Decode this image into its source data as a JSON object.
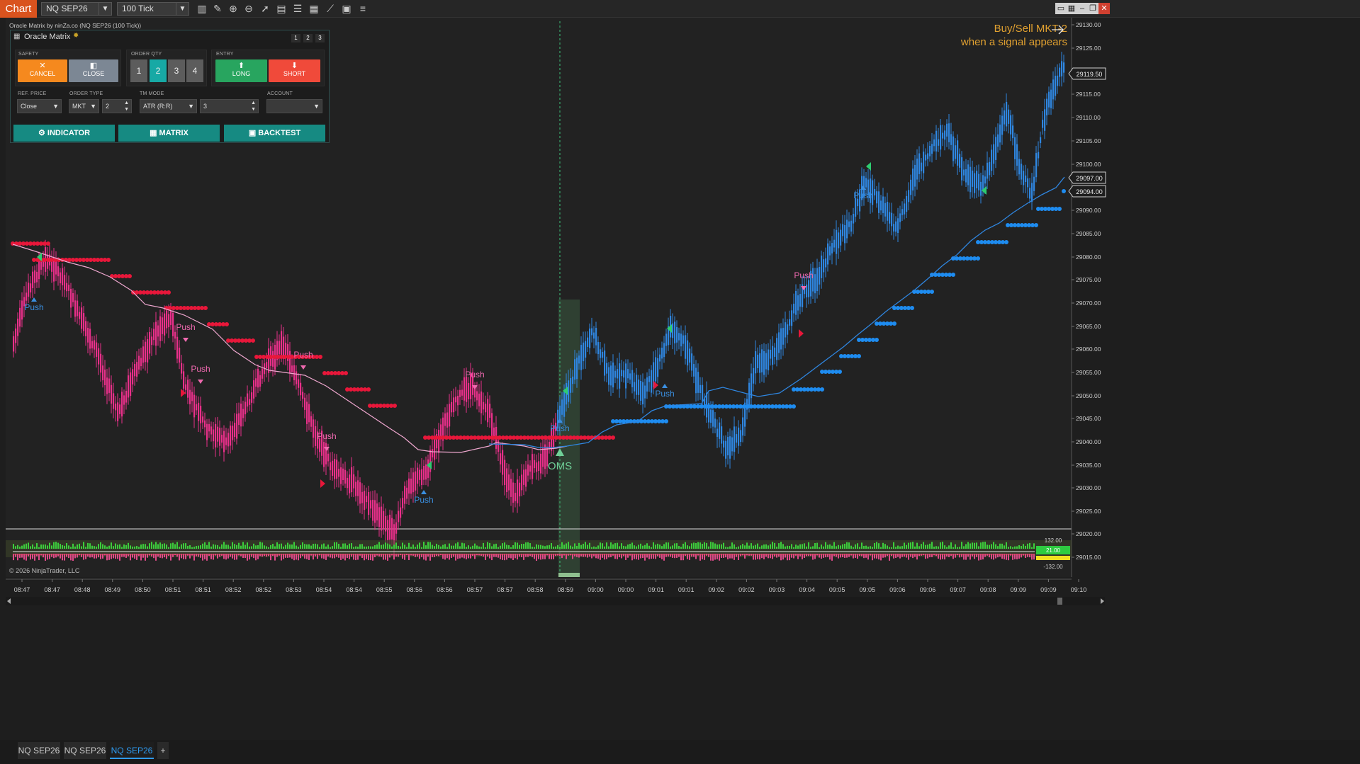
{
  "toolbar": {
    "chart_tab": "Chart",
    "instrument": "NQ SEP26",
    "interval": "100 Tick",
    "icons": [
      "bar-chart-icon",
      "draw-pencil-icon",
      "zoom-in-icon",
      "zoom-out-icon",
      "pointer-icon",
      "data-box-icon",
      "template-icon",
      "strategy-icon",
      "indicator-icon",
      "properties-icon",
      "list-icon"
    ]
  },
  "chart": {
    "title": "Oracle Matrix by ninZa.co (NQ SEP26 (100 Tick))",
    "copyright": "© 2026 NinjaTrader, LLC",
    "annotation_line1": "Buy/Sell MKT-2",
    "annotation_line2": "when a signal appears",
    "oms_label": "OMS",
    "push_label": "Push",
    "price_ticks": [
      "29130.00",
      "29125.00",
      "29115.00",
      "29110.00",
      "29105.00",
      "29100.00",
      "29090.00",
      "29085.00",
      "29080.00",
      "29075.00",
      "29070.00",
      "29065.00",
      "29060.00",
      "29055.00",
      "29050.00",
      "29045.00",
      "29040.00",
      "29035.00",
      "29030.00",
      "29025.00",
      "29020.00",
      "29015.00"
    ],
    "price_marker_last": "29119.50",
    "price_marker_2": "29097.00",
    "price_marker_3": "29094.00",
    "osc_top": "132.00",
    "osc_value": "21.00",
    "osc_bottom": "-132.00",
    "time_ticks": [
      "08:47",
      "08:47",
      "08:48",
      "08:49",
      "08:50",
      "08:51",
      "08:51",
      "08:52",
      "08:52",
      "08:53",
      "08:54",
      "08:54",
      "08:55",
      "08:56",
      "08:56",
      "08:57",
      "08:57",
      "08:58",
      "08:59",
      "09:00",
      "09:00",
      "09:01",
      "09:01",
      "09:02",
      "09:02",
      "09:03",
      "09:04",
      "09:05",
      "09:05",
      "09:06",
      "09:06",
      "09:07",
      "09:08",
      "09:09",
      "09:09",
      "09:10"
    ],
    "colors": {
      "bull": "#2f86e0",
      "bear": "#e8308a",
      "stop_red": "#e8173a",
      "stop_blue": "#1e8cf0",
      "signal_green": "#2ecc71",
      "annotation": "#e0a030"
    }
  },
  "oracle_panel": {
    "title": "Oracle Matrix",
    "pages": [
      "1",
      "2",
      "3"
    ],
    "safety_label": "SAFETY",
    "cancel_label": "CANCEL",
    "close_label": "CLOSE",
    "order_qty_label": "ORDER QTY",
    "qty_options": [
      "1",
      "2",
      "3",
      "4"
    ],
    "qty_selected": "2",
    "entry_label": "ENTRY",
    "long_label": "LONG",
    "short_label": "SHORT",
    "ref_price_label": "REF. PRICE",
    "ref_price_value": "Close",
    "order_type_label": "ORDER TYPE",
    "order_type_value": "MKT",
    "order_type_offset": "2",
    "tm_mode_label": "TM MODE",
    "tm_mode_value": "ATR (R:R)",
    "tm_mode_ratio": "3",
    "account_label": "ACCOUNT",
    "account_value": "",
    "indicator_btn": "INDICATOR",
    "matrix_btn": "MATRIX",
    "backtest_btn": "BACKTEST"
  },
  "bottom_tabs": [
    "NQ SEP26",
    "NQ SEP26",
    "NQ SEP26"
  ],
  "bottom_add": "+"
}
